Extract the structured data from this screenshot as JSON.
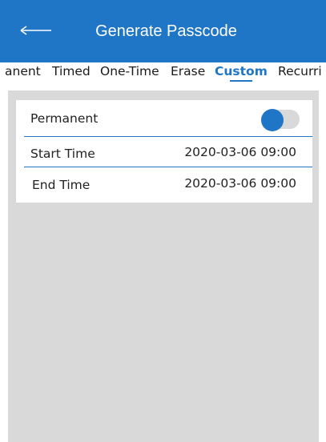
{
  "header": {
    "title": "Generate Passcode",
    "back_icon": "back-arrow-icon"
  },
  "tabs": [
    {
      "label": "anent"
    },
    {
      "label": "Timed"
    },
    {
      "label": "One-Time"
    },
    {
      "label": "Erase"
    },
    {
      "label": "Custom",
      "active": true
    },
    {
      "label": "Recurri"
    }
  ],
  "form": {
    "permanent_label": "Permanent",
    "permanent_enabled": true,
    "start_label": "Start Time",
    "start_value": "2020-03-06 09:00",
    "end_label": "End Time",
    "end_value": "2020-03-06 09:00"
  },
  "colors": {
    "accent": "#1f75c6",
    "background": "#d9d9d9"
  }
}
